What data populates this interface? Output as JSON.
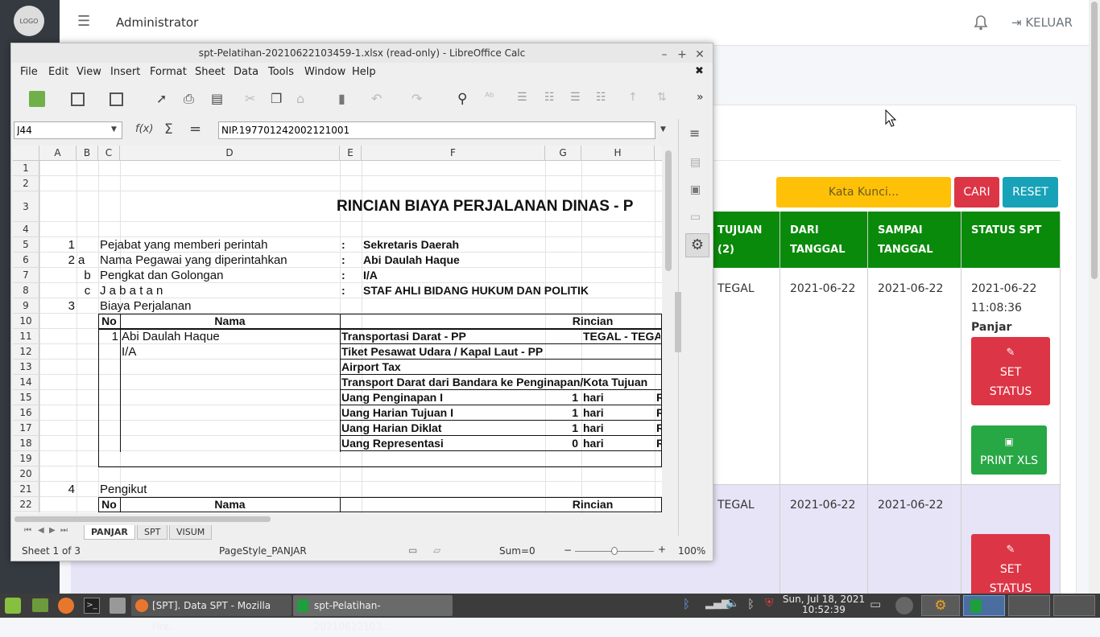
{
  "web": {
    "logo_text": "LOGO",
    "header_title": "Administrator",
    "logout_label": "KELUAR",
    "search_placeholder": "Kata Kunci...",
    "cari_label": "CARI",
    "reset_label": "RESET",
    "columns": {
      "tujuan": "TUJUAN (2)",
      "dari": "DARI TANGGAL",
      "sampai": "SAMPAI TANGGAL",
      "status": "STATUS SPT"
    },
    "rows": [
      {
        "tujuan": "TEGAL",
        "dari": "2021-06-22",
        "sampai": "2021-06-22",
        "status_date": "2021-06-22",
        "status_time": "11:08:36",
        "status_label": "Panjar",
        "set_status": "SET STATUS",
        "print_xls": "PRINT XLS"
      },
      {
        "tujuan": "TEGAL",
        "dari": "2021-06-22",
        "sampai": "2021-06-22",
        "set_status": "SET STATUS"
      }
    ]
  },
  "calc": {
    "title": "spt-Pelatihan-20210622103459-1.xlsx (read-only) - LibreOffice Calc",
    "menu": [
      "File",
      "Edit",
      "View",
      "Insert",
      "Format",
      "Sheet",
      "Data",
      "Tools",
      "Window",
      "Help"
    ],
    "name_box": "J44",
    "formula": "NIP.197701242002121001",
    "columns": [
      "A",
      "B",
      "C",
      "D",
      "E",
      "F",
      "G",
      "H"
    ],
    "rows": [
      "1",
      "2",
      "3",
      "4",
      "5",
      "6",
      "7",
      "8",
      "9",
      "10",
      "11",
      "12",
      "13",
      "14",
      "15",
      "16",
      "17",
      "18",
      "19",
      "20",
      "21",
      "22"
    ],
    "cells": {
      "title": "RINCIAN BIAYA PERJALANAN DINAS - P",
      "r5_no": "1",
      "r5_label": "Pejabat yang memberi perintah",
      "r5_colon": ":",
      "r5_val": "Sekretaris Daerah",
      "r6_no": "2",
      "r6_sub": "a",
      "r6_label": "Nama Pegawai yang diperintahkan",
      "r6_colon": ":",
      "r6_val": "Abi Daulah Haque",
      "r7_sub": "b",
      "r7_label": "Pengkat dan Golongan",
      "r7_colon": ":",
      "r7_val": "I/A",
      "r8_sub": "c",
      "r8_label": "J a b a t a n",
      "r8_colon": ":",
      "r8_val": "STAF AHLI BIDANG HUKUM DAN POLITIK",
      "r9_no": "3",
      "r9_label": "Biaya Perjalanan",
      "h_no": "No",
      "h_nama": "Nama",
      "h_rincian": "Rincian",
      "r11_no": "1",
      "r11_nama": "Abi Daulah Haque",
      "r11_item": "Transportasi Darat - PP",
      "r11_h": "TEGAL - TEGA",
      "r12_nama": "I/A",
      "r12_item": "Tiket Pesawat Udara / Kapal Laut - PP",
      "r13_item": "Airport Tax",
      "r14_item": "Transport Darat dari Bandara ke Penginapan/Kota Tujuan",
      "r15_item": "Uang Penginapan I",
      "r15_g": "1",
      "r15_h": "hari",
      "r15_i": "R",
      "r16_item": "Uang Harian Tujuan I",
      "r16_g": "1",
      "r16_h": "hari",
      "r16_i": "R",
      "r17_item": "Uang Harian Diklat",
      "r17_g": "1",
      "r17_h": "hari",
      "r17_i": "R",
      "r18_item": "Uang Representasi",
      "r18_g": "0",
      "r18_h": "hari",
      "r18_i": "R",
      "r21_no": "4",
      "r21_label": "Pengikut",
      "h2_no": "No",
      "h2_nama": "Nama",
      "h2_rincian": "Rincian"
    },
    "sheets": [
      "PANJAR",
      "SPT",
      "VISUM"
    ],
    "active_sheet": "PANJAR",
    "status": {
      "sheet": "Sheet 1 of 3",
      "style": "PageStyle_PANJAR",
      "sum": "Sum=0",
      "zoom": "100%",
      "zoom_fraction": 0.5
    }
  },
  "taskbar": {
    "firefox_task": "[SPT]. Data SPT - Mozilla Fire...",
    "calc_task": "spt-Pelatihan-20210622103...",
    "clock_date": "Sun, Jul 18, 2021",
    "clock_time": "10:52:39"
  }
}
